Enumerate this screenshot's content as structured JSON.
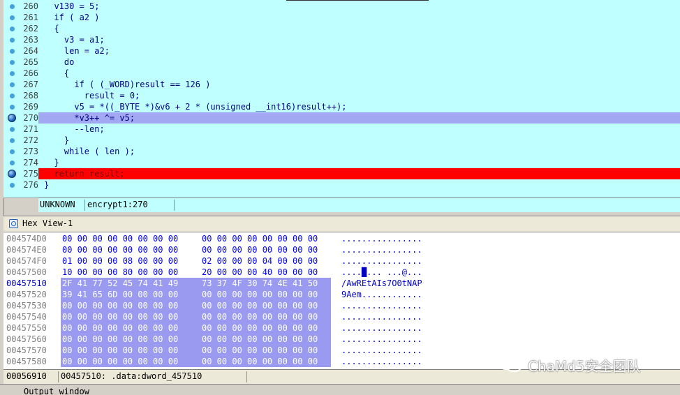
{
  "pseudocode": {
    "lines": [
      {
        "num": "260",
        "text": "  v130 = 5;"
      },
      {
        "num": "261",
        "text": "  if ( a2 )"
      },
      {
        "num": "262",
        "text": "  {"
      },
      {
        "num": "263",
        "text": "    v3 = a1;"
      },
      {
        "num": "264",
        "text": "    len = a2;"
      },
      {
        "num": "265",
        "text": "    do"
      },
      {
        "num": "266",
        "text": "    {"
      },
      {
        "num": "267",
        "text": "      if ( (_WORD)result == 126 )"
      },
      {
        "num": "268",
        "text": "        result = 0;"
      },
      {
        "num": "269",
        "text": "      v5 = *((_BYTE *)&v6 + 2 * (unsigned __int16)result++);"
      },
      {
        "num": "270",
        "text": "      *v3++ ^= v5;"
      },
      {
        "num": "271",
        "text": "      --len;"
      },
      {
        "num": "272",
        "text": "    }"
      },
      {
        "num": "273",
        "text": "    while ( len );"
      },
      {
        "num": "274",
        "text": "  }"
      },
      {
        "num": "275",
        "text": "  return result;"
      },
      {
        "num": "276",
        "text": "}"
      }
    ],
    "status_left": "UNKNOWN",
    "status_location": "encrypt1:270"
  },
  "hex_view": {
    "tab_label": "Hex View-1",
    "rows": [
      {
        "addr": "004574D0",
        "a": "00 00 00 00 00 00 00 00",
        "b": "00 00 00 00 00 00 00 00",
        "ascii": "................"
      },
      {
        "addr": "004574E0",
        "a": "00 00 00 00 00 00 00 00",
        "b": "00 00 00 00 00 00 00 00",
        "ascii": "................"
      },
      {
        "addr": "004574F0",
        "a": "01 00 00 00 08 00 00 00",
        "b": "02 00 00 00 04 00 00 00",
        "ascii": "................"
      },
      {
        "addr": "00457500",
        "a": "10 00 00 00 80 00 00 00",
        "b": "20 00 00 00 40 00 00 00",
        "ascii": "....█... ...@..."
      },
      {
        "addr": "00457510",
        "a": "2F 41 77 52 45 74 41 49",
        "b": "73 37 4F 30 74 4E 41 50",
        "ascii": "/AwREtAIs7O0tNAP"
      },
      {
        "addr": "00457520",
        "a": "39 41 65 6D 00 00 00 00",
        "b": "00 00 00 00 00 00 00 00",
        "ascii": "9Aem............"
      },
      {
        "addr": "00457530",
        "a": "00 00 00 00 00 00 00 00",
        "b": "00 00 00 00 00 00 00 00",
        "ascii": "................"
      },
      {
        "addr": "00457540",
        "a": "00 00 00 00 00 00 00 00",
        "b": "00 00 00 00 00 00 00 00",
        "ascii": "................"
      },
      {
        "addr": "00457550",
        "a": "00 00 00 00 00 00 00 00",
        "b": "00 00 00 00 00 00 00 00",
        "ascii": "................"
      },
      {
        "addr": "00457560",
        "a": "00 00 00 00 00 00 00 00",
        "b": "00 00 00 00 00 00 00 00",
        "ascii": "................"
      },
      {
        "addr": "00457570",
        "a": "00 00 00 00 00 00 00 00",
        "b": "00 00 00 00 00 00 00 00",
        "ascii": "................"
      },
      {
        "addr": "00457580",
        "a": "00 00 00 00 00 00 00 00",
        "b": "00 00 00 00 00 00 00 00",
        "ascii": "................"
      }
    ],
    "status_offset": "00056910",
    "status_location": "00457510: .data:dword_457510"
  },
  "bottom_panel_label": "Output window",
  "watermark": "ChaMd5安全团队",
  "colors": {
    "code_bg": "#c0ffff",
    "current_line": "#a3a8f2",
    "breakpoint_line": "#ff0000",
    "hex_selection": "#9a9af0"
  }
}
